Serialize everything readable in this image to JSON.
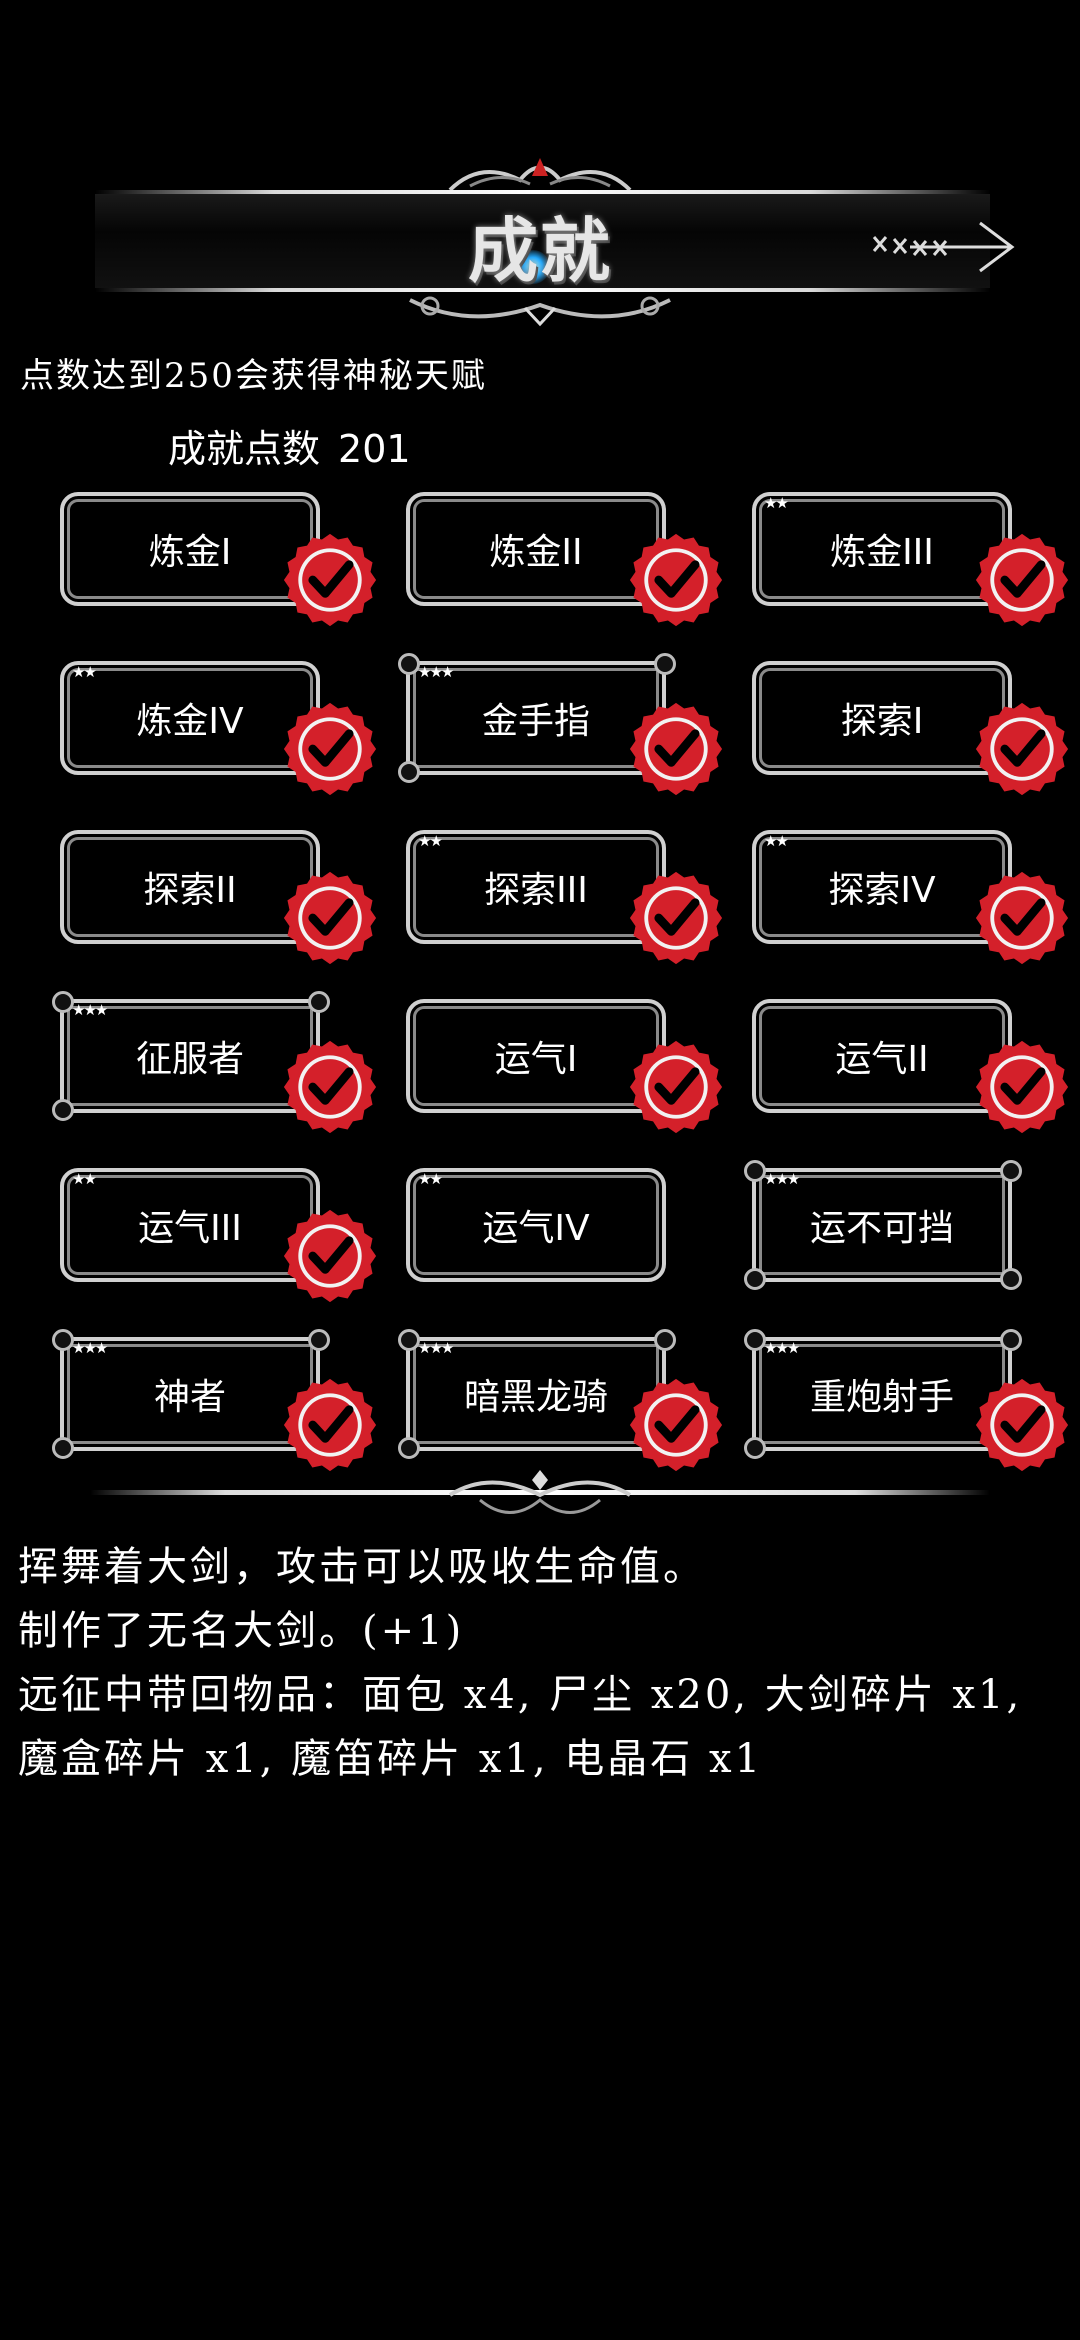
{
  "header": {
    "title": "成就",
    "close_label": "××××"
  },
  "hint": "点数达到250会获得神秘天赋",
  "points": {
    "label": "成就点数",
    "value": "201"
  },
  "achievements": [
    {
      "label": "炼金I",
      "stars": "",
      "ornate": false,
      "completed": true
    },
    {
      "label": "炼金II",
      "stars": "",
      "ornate": false,
      "completed": true
    },
    {
      "label": "炼金III",
      "stars": "★★",
      "ornate": false,
      "completed": true
    },
    {
      "label": "炼金IV",
      "stars": "★★",
      "ornate": false,
      "completed": true
    },
    {
      "label": "金手指",
      "stars": "★★★",
      "ornate": true,
      "completed": true
    },
    {
      "label": "探索I",
      "stars": "",
      "ornate": false,
      "completed": true
    },
    {
      "label": "探索II",
      "stars": "",
      "ornate": false,
      "completed": true
    },
    {
      "label": "探索III",
      "stars": "★★",
      "ornate": false,
      "completed": true
    },
    {
      "label": "探索IV",
      "stars": "★★",
      "ornate": false,
      "completed": true
    },
    {
      "label": "征服者",
      "stars": "★★★",
      "ornate": true,
      "completed": true
    },
    {
      "label": "运气I",
      "stars": "",
      "ornate": false,
      "completed": true
    },
    {
      "label": "运气II",
      "stars": "",
      "ornate": false,
      "completed": true
    },
    {
      "label": "运气III",
      "stars": "★★",
      "ornate": false,
      "completed": true
    },
    {
      "label": "运气IV",
      "stars": "★★",
      "ornate": false,
      "completed": false
    },
    {
      "label": "运不可挡",
      "stars": "★★★",
      "ornate": true,
      "completed": false
    },
    {
      "label": "神者",
      "stars": "★★★",
      "ornate": true,
      "completed": true
    },
    {
      "label": "暗黑龙骑",
      "stars": "★★★",
      "ornate": true,
      "completed": true
    },
    {
      "label": "重炮射手",
      "stars": "★★★",
      "ornate": true,
      "completed": true
    }
  ],
  "description": [
    "挥舞着大剑，攻击可以吸收生命值。",
    "制作了无名大剑。(+1)",
    "远征中带回物品：面包 x4, 尸尘 x20, 大剑碎片 x1,",
    "魔盒碎片 x1, 魔笛碎片 x1, 电晶石 x1"
  ],
  "colors": {
    "badge_red": "#d4202a",
    "frame": "#d0d0d0",
    "background": "#000000"
  }
}
